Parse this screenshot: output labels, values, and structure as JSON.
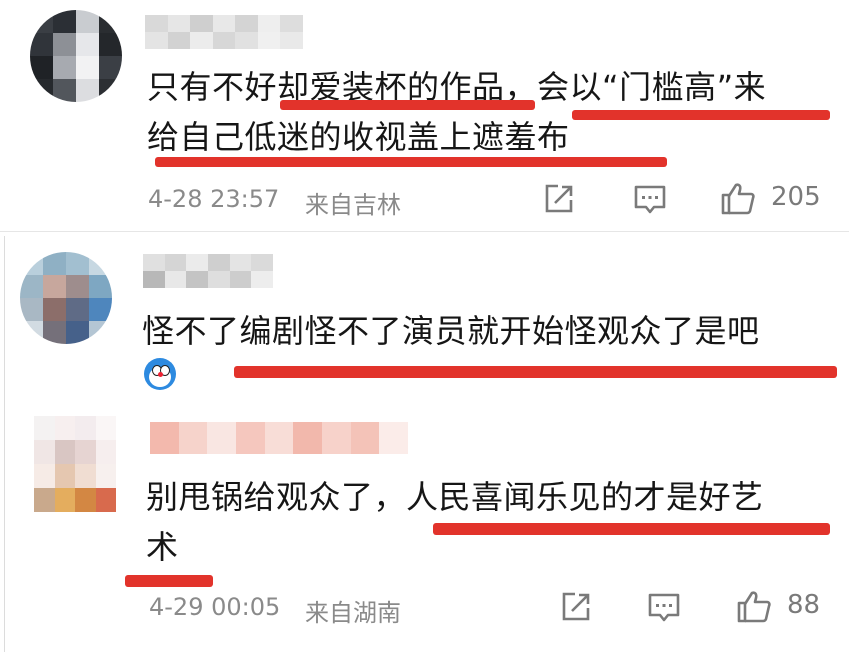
{
  "colors": {
    "underline": "#e2332b",
    "text": "#161616",
    "meta": "#8a8a8a"
  },
  "comments": [
    {
      "line1": "只有不好却爱装杯的作品，会以“门槛高”来",
      "line2": "给自己低迷的收视盖上遮羞布",
      "time": "4-28 23:57",
      "location": "来自吉林",
      "like_count": "205",
      "icons": [
        "share-icon",
        "comment-icon",
        "like-icon"
      ]
    },
    {
      "line1": "怪不了编剧怪不了演员就开始怪观众了是吧",
      "emoji": "doraemon-emoji"
    },
    {
      "line1": "别甩锅给观众了，人民喜闻乐见的才是好艺",
      "line2": "术",
      "time": "4-29 00:05",
      "location": "来自湖南",
      "like_count": "88",
      "icons": [
        "share-icon",
        "comment-icon",
        "like-icon"
      ]
    }
  ]
}
